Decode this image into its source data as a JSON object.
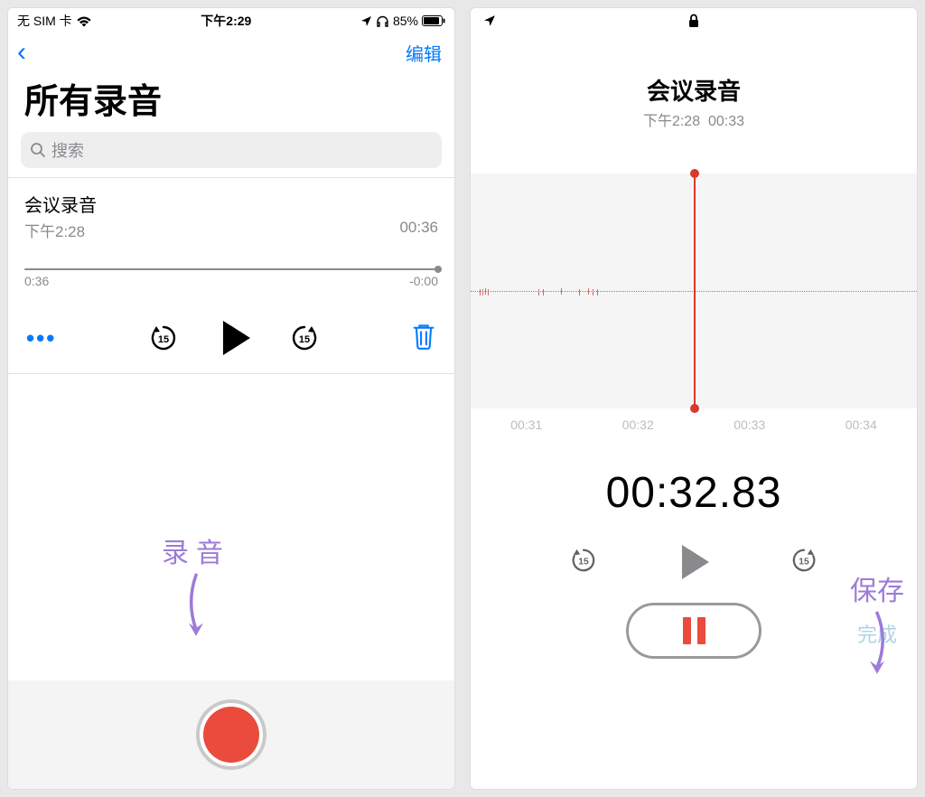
{
  "left": {
    "status": {
      "carrier": "无 SIM 卡",
      "time": "下午2:29",
      "battery": "85%"
    },
    "nav": {
      "edit": "编辑"
    },
    "title": "所有录音",
    "search_placeholder": "搜索",
    "recording": {
      "name": "会议录音",
      "time": "下午2:28",
      "duration": "00:36"
    },
    "slider": {
      "left": "0:36",
      "right": "-0:00"
    },
    "annotation": "录音"
  },
  "right": {
    "header": {
      "title": "会议录音",
      "time": "下午2:28",
      "elapsed": "00:33"
    },
    "ruler": [
      "00:31",
      "00:32",
      "00:33",
      "00:34"
    ],
    "timer": "00:32.83",
    "done": "完成",
    "annotation": "保存"
  }
}
